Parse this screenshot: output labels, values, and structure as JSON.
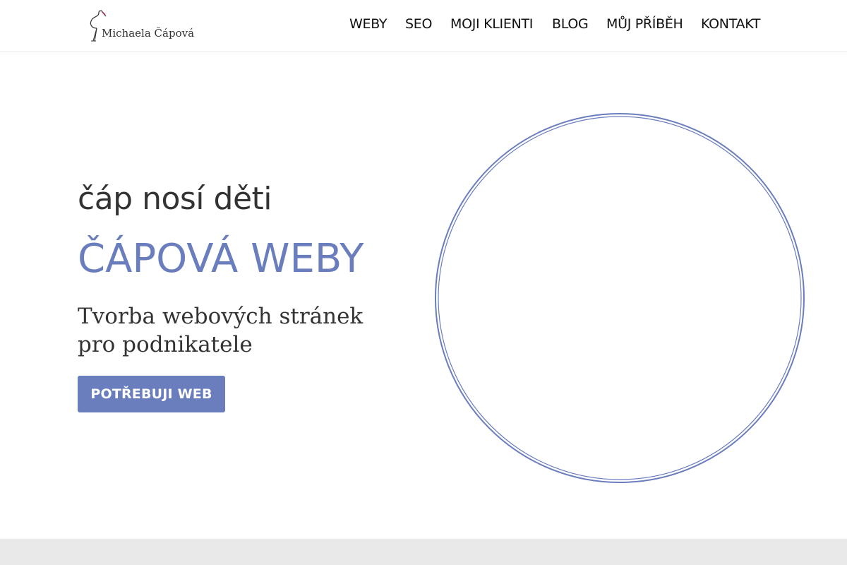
{
  "header": {
    "logo_text": "Michaela Čápová",
    "nav": [
      {
        "label": "WEBY"
      },
      {
        "label": "SEO"
      },
      {
        "label": "MOJI KLIENTI"
      },
      {
        "label": "BLOG"
      },
      {
        "label": "MŮJ PŘÍBĚH"
      },
      {
        "label": "KONTAKT"
      }
    ]
  },
  "hero": {
    "tagline": "čáp nosí děti",
    "title": "ČÁPOVÁ WEBY",
    "subtitle": "Tvorba webových stránek pro podnikatele",
    "cta_label": "POTŘEBUJI WEB"
  },
  "colors": {
    "accent": "#6a7dbd",
    "text": "#333333",
    "footer_strip": "#e9e9e9"
  }
}
